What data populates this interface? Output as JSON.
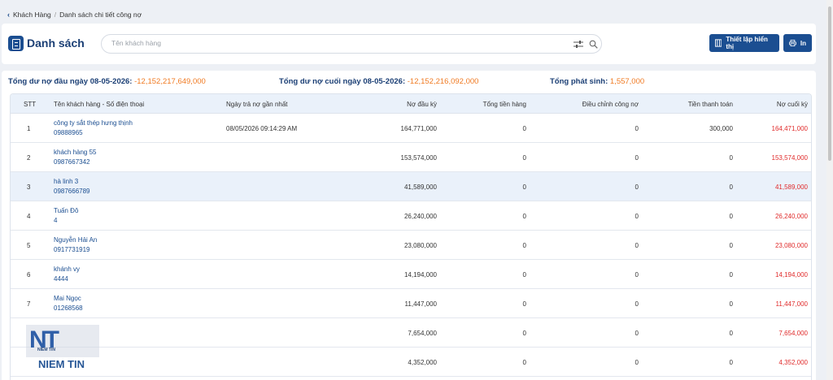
{
  "breadcrumb": {
    "parent": "Khách Hàng",
    "separator": "/",
    "current": "Danh sách chi tiết công nợ"
  },
  "header": {
    "title": "Danh sách",
    "search_placeholder": "Tên khách hàng",
    "settings_button": "Thiết lập hiển thị",
    "print_button": "In"
  },
  "summary": {
    "opening_label": "Tổng dư nợ đầu ngày 08-05-2026:",
    "opening_value": "-12,152,217,649,000",
    "closing_label": "Tổng dư nợ cuối ngày 08-05-2026:",
    "closing_value": "-12,152,216,092,000",
    "incurred_label": "Tổng phát sinh:",
    "incurred_value": "1,557,000"
  },
  "table": {
    "columns": [
      "STT",
      "Tên khách hàng - Số điện thoại",
      "Ngày trả nợ gần nhất",
      "Nợ đầu kỳ",
      "Tổng tiền hàng",
      "Điều chỉnh công nợ",
      "Tiền thanh toán",
      "Nợ cuối kỳ"
    ],
    "rows": [
      {
        "stt": "1",
        "name": "công ty sắt thép hưng thịnh",
        "phone": "09888965",
        "date": "08/05/2026 09:14:29 AM",
        "opening": "164,771,000",
        "goods": "0",
        "adjust": "0",
        "paid": "300,000",
        "closing": "164,471,000"
      },
      {
        "stt": "2",
        "name": "khách hàng 55",
        "phone": "0987667342",
        "date": "",
        "opening": "153,574,000",
        "goods": "0",
        "adjust": "0",
        "paid": "0",
        "closing": "153,574,000"
      },
      {
        "stt": "3",
        "name": "hà linh 3",
        "phone": "0987666789",
        "date": "",
        "opening": "41,589,000",
        "goods": "0",
        "adjust": "0",
        "paid": "0",
        "closing": "41,589,000"
      },
      {
        "stt": "4",
        "name": "Tuấn Đô",
        "phone": "4",
        "date": "",
        "opening": "26,240,000",
        "goods": "0",
        "adjust": "0",
        "paid": "0",
        "closing": "26,240,000"
      },
      {
        "stt": "5",
        "name": "Nguyễn Hải An",
        "phone": "0917731919",
        "date": "",
        "opening": "23,080,000",
        "goods": "0",
        "adjust": "0",
        "paid": "0",
        "closing": "23,080,000"
      },
      {
        "stt": "6",
        "name": "khánh vy",
        "phone": "4444",
        "date": "",
        "opening": "14,194,000",
        "goods": "0",
        "adjust": "0",
        "paid": "0",
        "closing": "14,194,000"
      },
      {
        "stt": "7",
        "name": "Mai Ngọc",
        "phone": "01268568",
        "date": "",
        "opening": "11,447,000",
        "goods": "0",
        "adjust": "0",
        "paid": "0",
        "closing": "11,447,000"
      },
      {
        "stt": "",
        "name": "",
        "phone": "",
        "date": "",
        "opening": "7,654,000",
        "goods": "0",
        "adjust": "0",
        "paid": "0",
        "closing": "7,654,000"
      },
      {
        "stt": "",
        "name": "",
        "phone": "",
        "date": "",
        "opening": "4,352,000",
        "goods": "0",
        "adjust": "0",
        "paid": "0",
        "closing": "4,352,000"
      }
    ]
  },
  "watermark": {
    "logo": "NT",
    "small": "NIỀM TIN",
    "text": "NIEM TIN"
  },
  "colors": {
    "primary": "#1b4e91",
    "accent": "#f07a22",
    "negative": "#e02b2b"
  }
}
